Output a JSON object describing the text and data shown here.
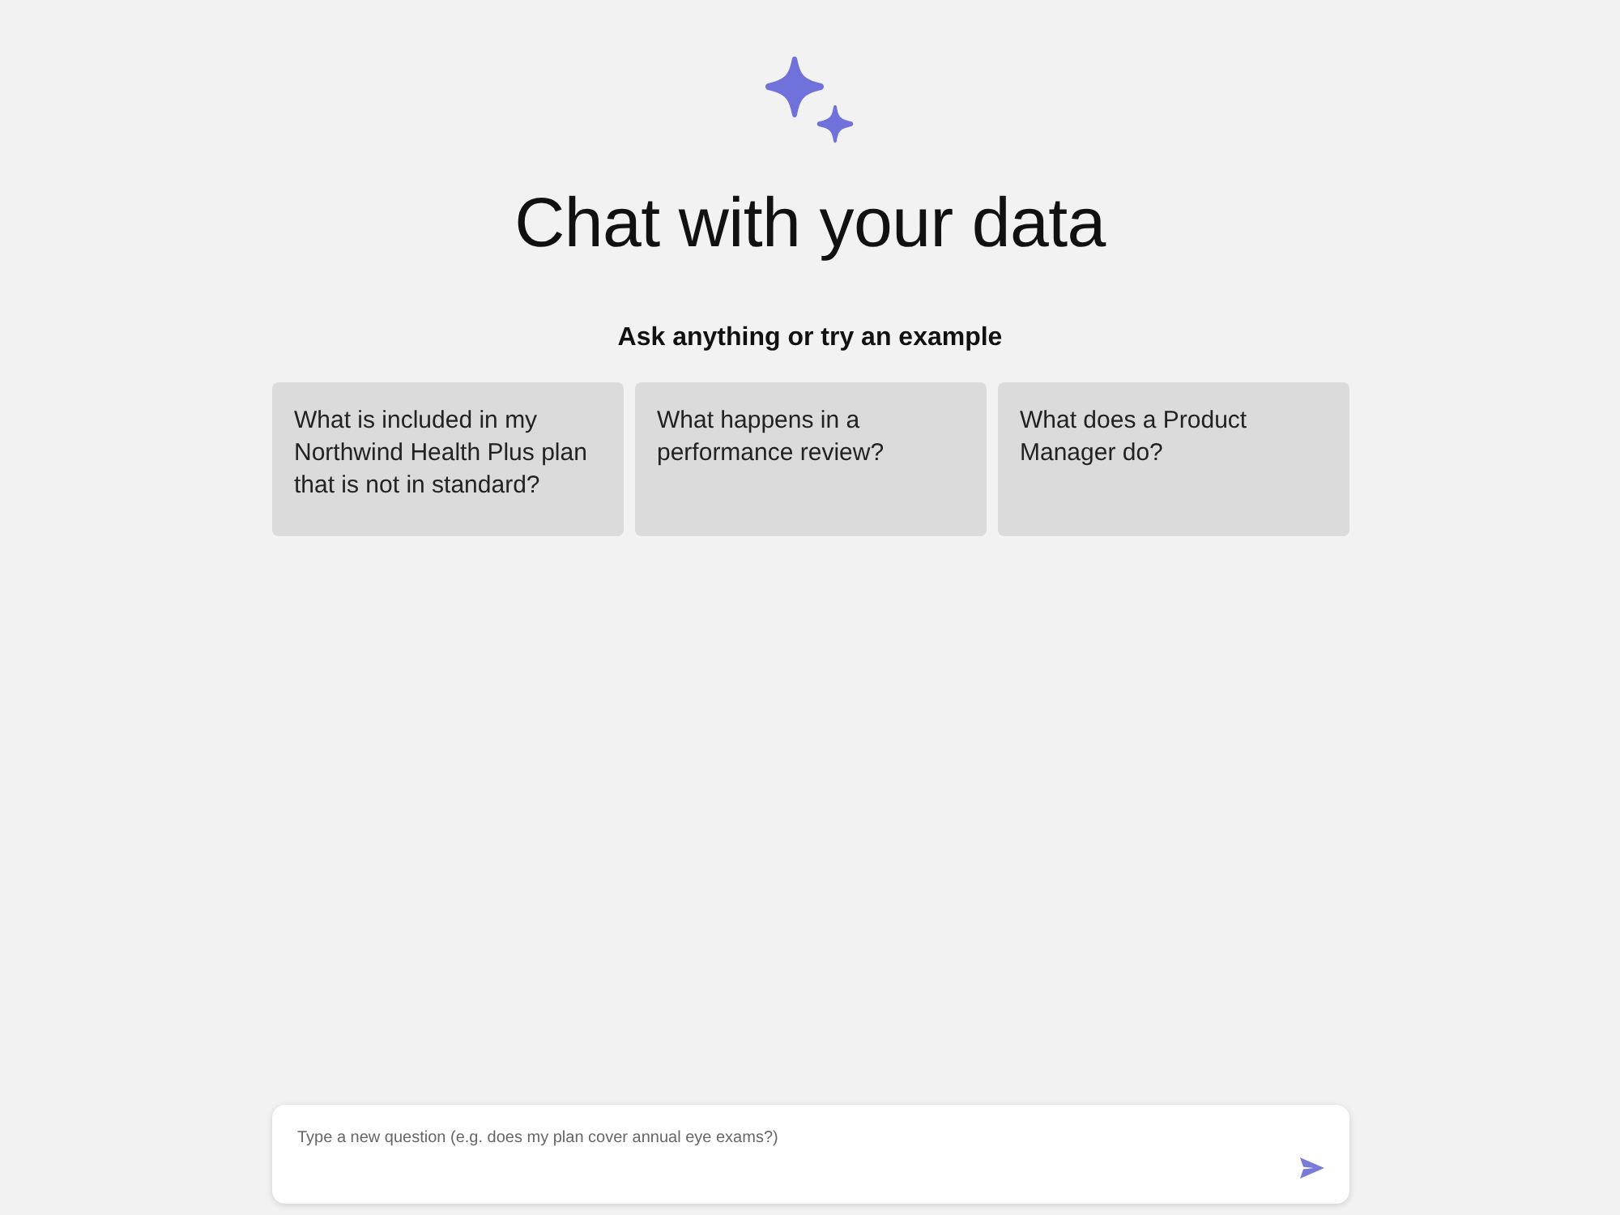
{
  "header": {
    "title": "Chat with your data",
    "subtitle": "Ask anything or try an example"
  },
  "examples": [
    {
      "text": "What is included in my Northwind Health Plus plan that is not in standard?"
    },
    {
      "text": "What happens in a performance review?"
    },
    {
      "text": "What does a Product Manager do?"
    }
  ],
  "question_input": {
    "placeholder": "Type a new question (e.g. does my plan cover annual eye exams?)"
  }
}
